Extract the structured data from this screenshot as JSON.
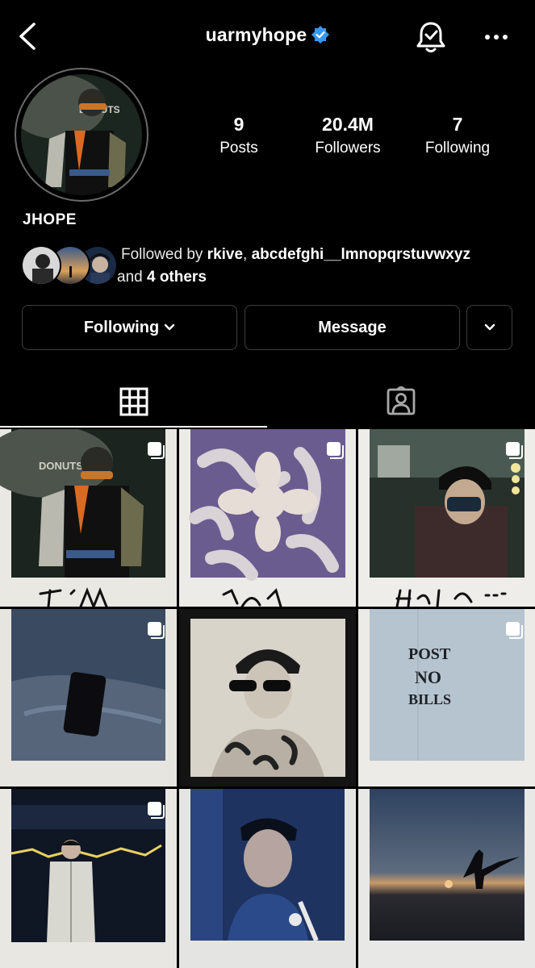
{
  "header": {
    "username": "uarmyhope",
    "verified": true,
    "back_icon": "chevron-left-icon",
    "bell_icon": "bell-check-icon",
    "more_icon": "more-horizontal-icon"
  },
  "profile": {
    "display_name": "JHOPE",
    "stats": [
      {
        "value": "9",
        "label": "Posts"
      },
      {
        "value": "20.4M",
        "label": "Followers"
      },
      {
        "value": "7",
        "label": "Following"
      }
    ],
    "followed_by": {
      "prefix": "Followed by ",
      "user1": "rkive",
      "sep": ", ",
      "user2": "abcdefghi__lmnopqrstuvwxyz",
      "and": " and ",
      "others": "4 others"
    }
  },
  "actions": {
    "following_label": "Following",
    "message_label": "Message"
  },
  "tabs": [
    {
      "name": "grid",
      "icon": "grid-icon",
      "active": true
    },
    {
      "name": "tagged",
      "icon": "tagged-person-icon",
      "active": false
    }
  ],
  "posts": [
    {
      "handwriting": "I'm",
      "multi": true
    },
    {
      "handwriting": "Your",
      "multi": true
    },
    {
      "handwriting": "Hope",
      "multi": true
    },
    {
      "handwriting": "",
      "multi": true
    },
    {
      "handwriting": "",
      "multi": false
    },
    {
      "handwriting": "POST NO BILLS",
      "multi": true
    },
    {
      "handwriting": "",
      "multi": true
    },
    {
      "handwriting": "",
      "multi": false
    },
    {
      "handwriting": "",
      "multi": false
    }
  ],
  "colors": {
    "accent_verified": "#3897f0",
    "border": "#3e3e3e",
    "background": "#000000"
  }
}
